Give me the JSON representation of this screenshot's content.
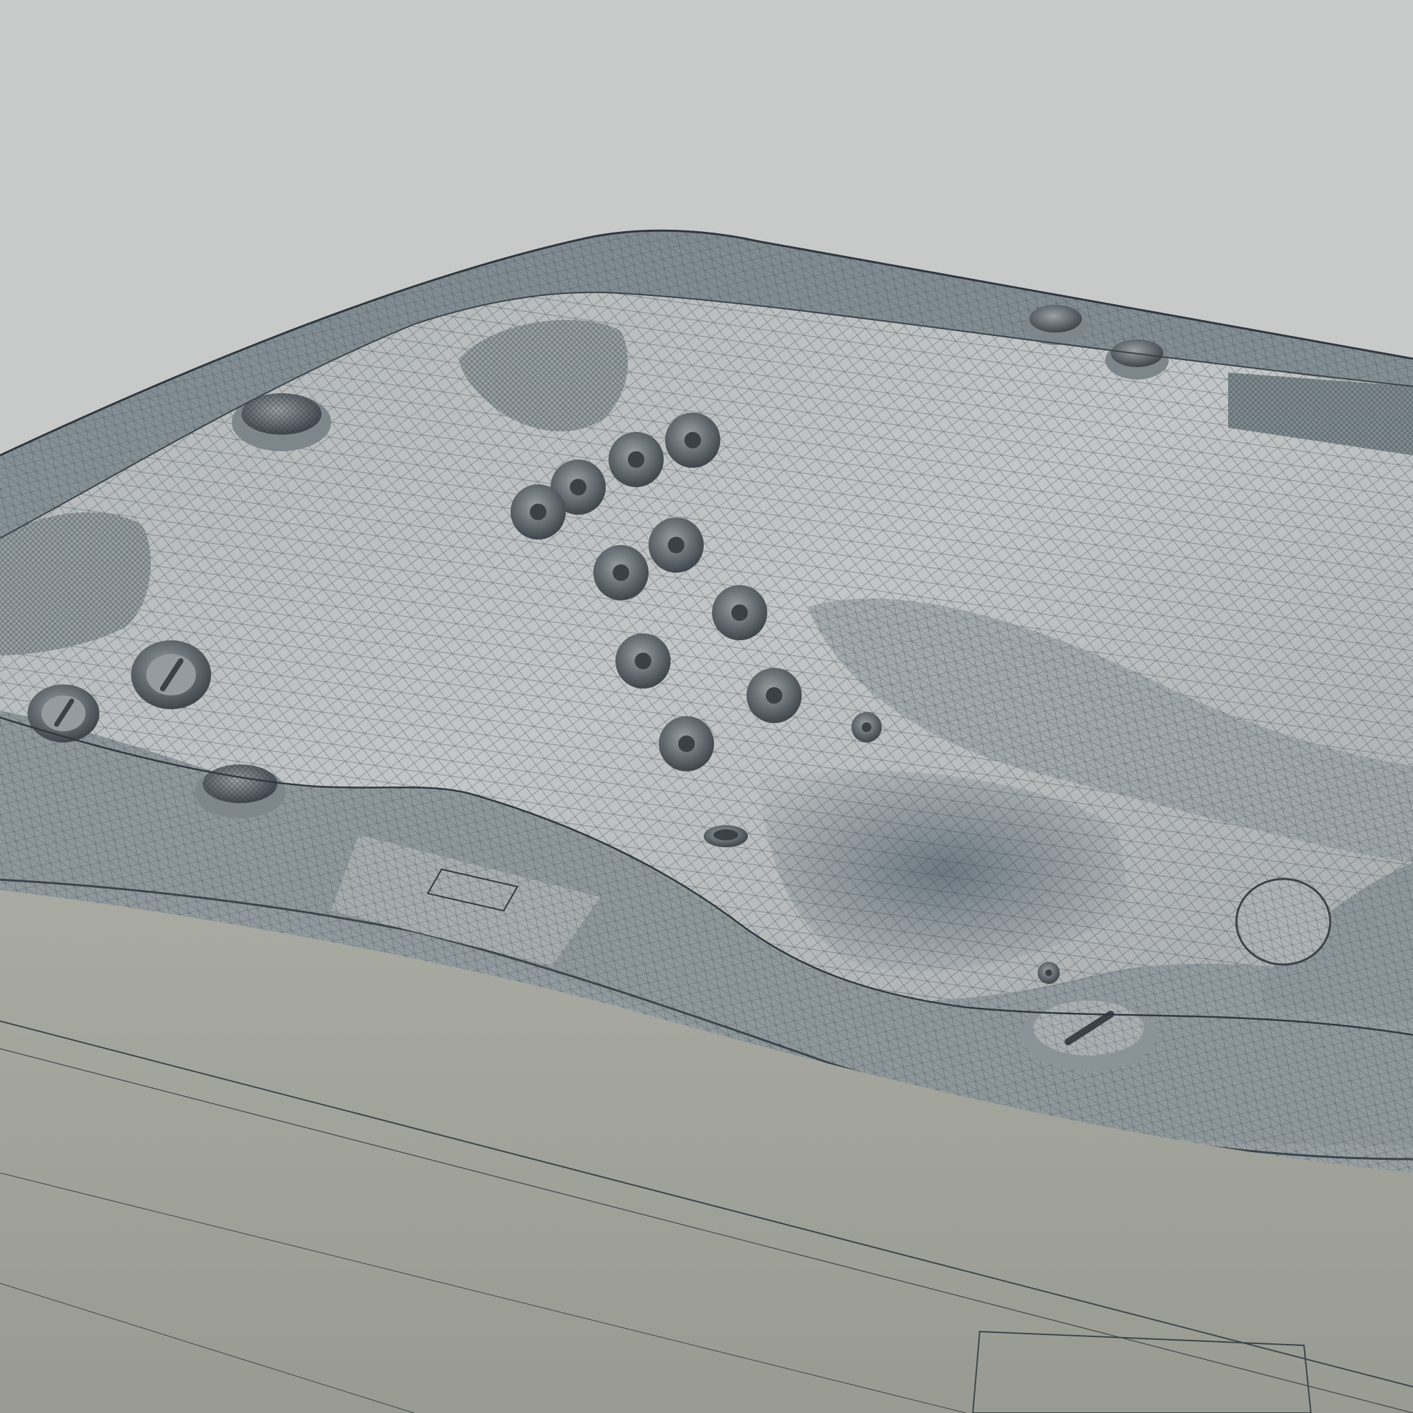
{
  "scene": {
    "subject": "hot-tub-wireframe-render",
    "colors": {
      "background": "#c8c9c9",
      "shell_light": "#b9bcbc",
      "shell_mid": "#9fa5a7",
      "shell_shadow": "#6f7b82",
      "rim": "#8d979b",
      "cabinet": "#a7a99f",
      "mesh_line": "#37414a",
      "jet": "#6c7478"
    },
    "counts": {
      "wall_jets": 12,
      "side_jets": 2,
      "headrests": 2,
      "deck_caps": 5
    }
  }
}
